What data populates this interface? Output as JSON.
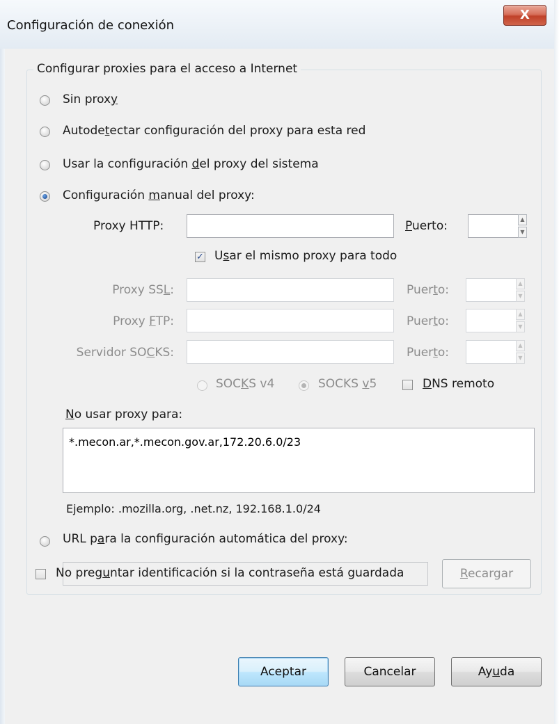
{
  "window": {
    "title": "Configuración de conexión",
    "close_label": "X"
  },
  "group": {
    "title": "Configurar proxies para el acceso a Internet"
  },
  "options": {
    "no_proxy": {
      "pre": "Sin prox",
      "u": "y",
      "post": "",
      "checked": false
    },
    "auto_detect": {
      "pre": "Autode",
      "u": "t",
      "post": "ectar configuración del proxy para esta red",
      "checked": false
    },
    "system": {
      "pre": "Usar la configuración ",
      "u": "d",
      "post": "el proxy del sistema",
      "checked": false
    },
    "manual": {
      "pre": "Configuración ",
      "u": "m",
      "post": "anual del proxy:",
      "checked": true
    },
    "auto_url": {
      "pre": "URL p",
      "u": "a",
      "post": "ra la configuración automática del proxy:",
      "checked": false
    }
  },
  "manual": {
    "http": {
      "label": "Proxy HTTP:",
      "value": "",
      "port_label_u": "P",
      "port_label_rest": "uerto:",
      "port_value": ""
    },
    "same_proxy": {
      "pre": "U",
      "u": "s",
      "post": "ar el mismo proxy para todo",
      "checked": true
    },
    "ssl": {
      "pre": "Proxy SS",
      "u": "L",
      "post": ":",
      "value": "",
      "port_pre": "Puer",
      "port_u": "t",
      "port_post": "o:",
      "port_value": ""
    },
    "ftp": {
      "pre": "Proxy ",
      "u": "F",
      "post": "TP:",
      "value": "",
      "port_pre": "Puer",
      "port_u": "t",
      "port_post": "o:",
      "port_value": ""
    },
    "socks": {
      "pre": "Servidor SO",
      "u": "C",
      "post": "KS:",
      "value": "",
      "port_pre": "Puer",
      "port_u": "t",
      "port_post": "o:",
      "port_value": ""
    },
    "socks_v4": {
      "pre": "SOC",
      "u": "K",
      "post": "S v4",
      "checked": false
    },
    "socks_v5": {
      "pre": "SOCKS ",
      "u": "v",
      "post": "5",
      "checked": true
    },
    "dns_remote": {
      "pre": "",
      "u": "D",
      "post": "NS remoto",
      "checked": false
    }
  },
  "no_proxy_for": {
    "label_u": "N",
    "label_rest": "o usar proxy para:",
    "value": "*.mecon.ar,*.mecon.gov.ar,172.20.6.0/23",
    "example": "Ejemplo: .mozilla.org, .net.nz, 192.168.1.0/24"
  },
  "auto_url": {
    "value": "",
    "reload_u": "R",
    "reload_rest": "ecargar"
  },
  "no_prompt_auth": {
    "pre": "No preg",
    "u": "u",
    "post": "ntar identificación si la contraseña está guardada",
    "checked": false
  },
  "buttons": {
    "ok": "Aceptar",
    "cancel": "Cancelar",
    "help_pre": "Ay",
    "help_u": "u",
    "help_post": "da"
  }
}
